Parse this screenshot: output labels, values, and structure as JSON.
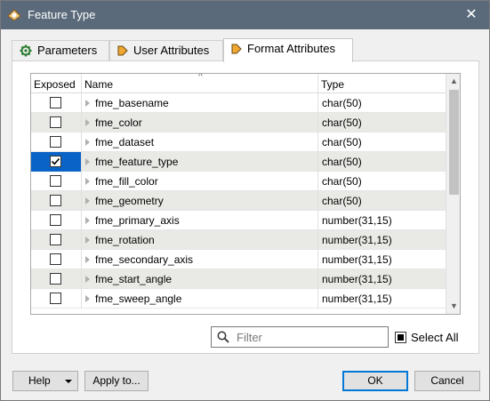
{
  "window": {
    "title": "Feature Type",
    "close_glyph": "✕"
  },
  "tabs": [
    {
      "label": "Parameters",
      "icon": "gear-icon"
    },
    {
      "label": "User Attributes",
      "icon": "arrow-right-icon"
    },
    {
      "label": "Format Attributes",
      "icon": "arrow-right-icon",
      "active": true
    }
  ],
  "table": {
    "columns": [
      "Exposed",
      "Name",
      "Type"
    ],
    "rows": [
      {
        "exposed": false,
        "name": "fme_basename",
        "type": "char(50)"
      },
      {
        "exposed": false,
        "name": "fme_color",
        "type": "char(50)"
      },
      {
        "exposed": false,
        "name": "fme_dataset",
        "type": "char(50)"
      },
      {
        "exposed": true,
        "name": "fme_feature_type",
        "type": "char(50)",
        "selected": true
      },
      {
        "exposed": false,
        "name": "fme_fill_color",
        "type": "char(50)"
      },
      {
        "exposed": false,
        "name": "fme_geometry",
        "type": "char(50)"
      },
      {
        "exposed": false,
        "name": "fme_primary_axis",
        "type": "number(31,15)"
      },
      {
        "exposed": false,
        "name": "fme_rotation",
        "type": "number(31,15)"
      },
      {
        "exposed": false,
        "name": "fme_secondary_axis",
        "type": "number(31,15)"
      },
      {
        "exposed": false,
        "name": "fme_start_angle",
        "type": "number(31,15)"
      },
      {
        "exposed": false,
        "name": "fme_sweep_angle",
        "type": "number(31,15)"
      }
    ]
  },
  "filter": {
    "placeholder": "Filter",
    "value": ""
  },
  "select_all": {
    "label": "Select All",
    "state": "indeterminate"
  },
  "buttons": {
    "help": "Help",
    "apply": "Apply to...",
    "ok": "OK",
    "cancel": "Cancel"
  },
  "colors": {
    "titlebar": "#5a6a7a",
    "selection": "#0a64c8",
    "alt_row": "#e9e9e6",
    "primary_border": "#0078d7"
  }
}
